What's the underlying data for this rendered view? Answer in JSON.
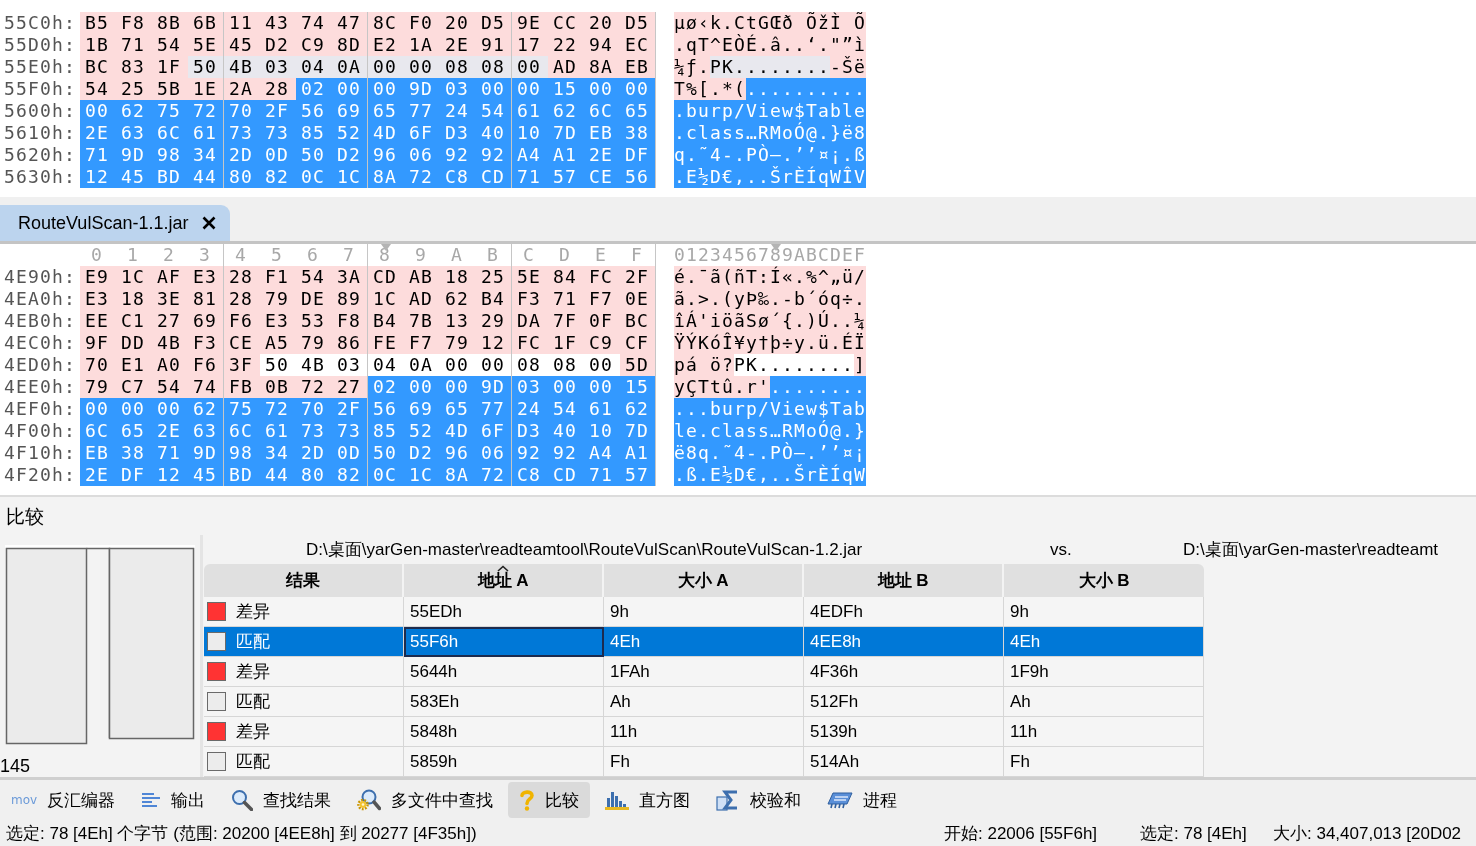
{
  "hex_views": [
    {
      "focused": false,
      "rows": [
        {
          "offset": "55C0h:",
          "segments": [
            {
              "kind": "diff",
              "hex": [
                "B5",
                "F8",
                "8B",
                "6B",
                "11",
                "43",
                "74",
                "47",
                "8C",
                "F0",
                "20",
                "D5",
                "9E",
                "CC",
                "20",
                "D5"
              ],
              "text": "µø‹k.CtGŒð ÕžÌ Õ"
            }
          ]
        },
        {
          "offset": "55D0h:",
          "segments": [
            {
              "kind": "diff",
              "hex": [
                "1B",
                "71",
                "54",
                "5E",
                "45",
                "D2",
                "C9",
                "8D",
                "E2",
                "1A",
                "2E",
                "91",
                "17",
                "22",
                "94",
                "EC"
              ],
              "text": ".qT^EÒÉ.â..‘.\"”ì"
            }
          ]
        },
        {
          "offset": "55E0h:",
          "segments": [
            {
              "kind": "diff",
              "hex": [
                "BC",
                "83",
                "1F"
              ],
              "text": "¼ƒ."
            },
            {
              "kind": "match",
              "hex": [
                "50",
                "4B",
                "03",
                "04",
                "0A",
                "00",
                "00",
                "08",
                "08",
                "00"
              ],
              "text": "PK........"
            },
            {
              "kind": "diff",
              "hex": [
                "AD",
                "8A",
                "EB"
              ],
              "text": "-Šë"
            }
          ]
        },
        {
          "offset": "55F0h:",
          "segments": [
            {
              "kind": "diff",
              "hex": [
                "54",
                "25",
                "5B",
                "1E",
                "2A",
                "28"
              ],
              "text": "T%[.*("
            },
            {
              "kind": "selected",
              "hex": [
                "02",
                "00",
                "00",
                "9D",
                "03",
                "00",
                "00",
                "15",
                "00",
                "00"
              ],
              "text": ".........."
            }
          ]
        },
        {
          "offset": "5600h:",
          "segments": [
            {
              "kind": "selected",
              "hex": [
                "00",
                "62",
                "75",
                "72",
                "70",
                "2F",
                "56",
                "69",
                "65",
                "77",
                "24",
                "54",
                "61",
                "62",
                "6C",
                "65"
              ],
              "text": ".burp/View$Table"
            }
          ]
        },
        {
          "offset": "5610h:",
          "segments": [
            {
              "kind": "selected",
              "hex": [
                "2E",
                "63",
                "6C",
                "61",
                "73",
                "73",
                "85",
                "52",
                "4D",
                "6F",
                "D3",
                "40",
                "10",
                "7D",
                "EB",
                "38"
              ],
              "text": ".class…RMoÓ@.}ë8"
            }
          ]
        },
        {
          "offset": "5620h:",
          "segments": [
            {
              "kind": "selected",
              "hex": [
                "71",
                "9D",
                "98",
                "34",
                "2D",
                "0D",
                "50",
                "D2",
                "96",
                "06",
                "92",
                "92",
                "A4",
                "A1",
                "2E",
                "DF"
              ],
              "text": "q.˜4-.PÒ–.’’¤¡.ß"
            }
          ]
        },
        {
          "offset": "5630h:",
          "segments": [
            {
              "kind": "selected",
              "hex": [
                "12",
                "45",
                "BD",
                "44",
                "80",
                "82",
                "0C",
                "1C",
                "8A",
                "72",
                "C8",
                "CD",
                "71",
                "57",
                "CE",
                "56"
              ],
              "text": ".E½D€‚..ŠrÈÍqWÎV"
            }
          ]
        }
      ]
    },
    {
      "tab": {
        "label": "RouteVulScan-1.1.jar",
        "selected": true
      },
      "focused": true,
      "columns": [
        {
          "label": "0",
          "marked": false
        },
        {
          "label": "1",
          "marked": false
        },
        {
          "label": "2",
          "marked": false
        },
        {
          "label": "3",
          "marked": false
        },
        {
          "label": "4",
          "marked": false
        },
        {
          "label": "5",
          "marked": false
        },
        {
          "label": "6",
          "marked": false
        },
        {
          "label": "7",
          "marked": false
        },
        {
          "label": "8",
          "marked": true
        },
        {
          "label": "9",
          "marked": false
        },
        {
          "label": "A",
          "marked": false
        },
        {
          "label": "B",
          "marked": false
        },
        {
          "label": "C",
          "marked": false
        },
        {
          "label": "D",
          "marked": false
        },
        {
          "label": "E",
          "marked": false
        },
        {
          "label": "F",
          "marked": false
        }
      ],
      "text_header": "0123456789ABCDEF",
      "rows": [
        {
          "offset": "4E90h:",
          "segments": [
            {
              "kind": "diff",
              "hex": [
                "E9",
                "1C",
                "AF",
                "E3",
                "28",
                "F1",
                "54",
                "3A",
                "CD",
                "AB",
                "18",
                "25",
                "5E",
                "84",
                "FC",
                "2F"
              ],
              "text": "é.¯ã(ñT:Í«.%^„ü/"
            }
          ]
        },
        {
          "offset": "4EA0h:",
          "segments": [
            {
              "kind": "diff",
              "hex": [
                "E3",
                "18",
                "3E",
                "81",
                "28",
                "79",
                "DE",
                "89",
                "1C",
                "AD",
                "62",
                "B4",
                "F3",
                "71",
                "F7",
                "0E"
              ],
              "text": "ã.>.(yÞ‰.-b´óq÷."
            }
          ]
        },
        {
          "offset": "4EB0h:",
          "segments": [
            {
              "kind": "diff",
              "hex": [
                "EE",
                "C1",
                "27",
                "69",
                "F6",
                "E3",
                "53",
                "F8",
                "B4",
                "7B",
                "13",
                "29",
                "DA",
                "7F",
                "0F",
                "BC"
              ],
              "text": "îÁ'iöãSø´{.)Ú..¼"
            }
          ]
        },
        {
          "offset": "4EC0h:",
          "segments": [
            {
              "kind": "diff",
              "hex": [
                "9F",
                "DD",
                "4B",
                "F3",
                "CE",
                "A5",
                "79",
                "86",
                "FE",
                "F7",
                "79",
                "12",
                "FC",
                "1F",
                "C9",
                "CF"
              ],
              "text": "ŸÝKóÎ¥y†þ÷y.ü.ÉÏ"
            }
          ]
        },
        {
          "offset": "4ED0h:",
          "segments": [
            {
              "kind": "diff",
              "hex": [
                "70",
                "E1",
                "A0",
                "F6",
                "3F"
              ],
              "text": "pá ö?"
            },
            {
              "kind": "match",
              "hex": [
                "50",
                "4B",
                "03",
                "04",
                "0A",
                "00",
                "00",
                "08",
                "08",
                "00"
              ],
              "text": "PK........"
            },
            {
              "kind": "diff",
              "hex": [
                "5D"
              ],
              "text": "]"
            }
          ]
        },
        {
          "offset": "4EE0h:",
          "segments": [
            {
              "kind": "diff",
              "hex": [
                "79",
                "C7",
                "54",
                "74",
                "FB",
                "0B",
                "72",
                "27"
              ],
              "text": "yÇTtû.r'"
            },
            {
              "kind": "selected",
              "hex": [
                "02",
                "00",
                "00",
                "9D",
                "03",
                "00",
                "00",
                "15"
              ],
              "text": "........"
            }
          ]
        },
        {
          "offset": "4EF0h:",
          "segments": [
            {
              "kind": "selected",
              "hex": [
                "00",
                "00",
                "00",
                "62",
                "75",
                "72",
                "70",
                "2F",
                "56",
                "69",
                "65",
                "77",
                "24",
                "54",
                "61",
                "62"
              ],
              "text": "...burp/View$Tab"
            }
          ]
        },
        {
          "offset": "4F00h:",
          "segments": [
            {
              "kind": "selected",
              "hex": [
                "6C",
                "65",
                "2E",
                "63",
                "6C",
                "61",
                "73",
                "73",
                "85",
                "52",
                "4D",
                "6F",
                "D3",
                "40",
                "10",
                "7D"
              ],
              "text": "le.class…RMoÓ@.}"
            }
          ]
        },
        {
          "offset": "4F10h:",
          "segments": [
            {
              "kind": "selected",
              "hex": [
                "EB",
                "38",
                "71",
                "9D",
                "98",
                "34",
                "2D",
                "0D",
                "50",
                "D2",
                "96",
                "06",
                "92",
                "92",
                "A4",
                "A1"
              ],
              "text": "ë8q.˜4-.PÒ–.’’¤¡"
            }
          ]
        },
        {
          "offset": "4F20h:",
          "segments": [
            {
              "kind": "selected",
              "hex": [
                "2E",
                "DF",
                "12",
                "45",
                "BD",
                "44",
                "80",
                "82",
                "0C",
                "1C",
                "8A",
                "72",
                "C8",
                "CD",
                "71",
                "57"
              ],
              "text": ".ß.E½D€‚..ŠrÈÍqW"
            }
          ]
        }
      ]
    }
  ],
  "compare": {
    "title": "比较",
    "overview_count": "145",
    "file_a": "D:\\桌面\\yarGen-master\\readteamtool\\RouteVulScan\\RouteVulScan-1.2.jar",
    "versus": "vs.",
    "file_b": "D:\\桌面\\yarGen-master\\readteamt",
    "columns": [
      {
        "label": "结果",
        "sorted": false
      },
      {
        "label": "地址 A",
        "sorted": true
      },
      {
        "label": "大小 A",
        "sorted": false
      },
      {
        "label": "地址 B",
        "sorted": false
      },
      {
        "label": "大小 B",
        "sorted": false
      }
    ],
    "rows": [
      {
        "result": "差异",
        "color": "#ff3333",
        "selected": false,
        "cells": [
          {
            "text": "55EDh",
            "focused": false
          },
          {
            "text": "9h",
            "focused": false
          },
          {
            "text": "4EDFh",
            "focused": false
          },
          {
            "text": "9h",
            "focused": false
          }
        ]
      },
      {
        "result": "匹配",
        "color": "#ececec",
        "selected": true,
        "cells": [
          {
            "text": "55F6h",
            "focused": true
          },
          {
            "text": "4Eh",
            "focused": false
          },
          {
            "text": "4EE8h",
            "focused": false
          },
          {
            "text": "4Eh",
            "focused": false
          }
        ]
      },
      {
        "result": "差异",
        "color": "#ff3333",
        "selected": false,
        "cells": [
          {
            "text": "5644h",
            "focused": false
          },
          {
            "text": "1FAh",
            "focused": false
          },
          {
            "text": "4F36h",
            "focused": false
          },
          {
            "text": "1F9h",
            "focused": false
          }
        ]
      },
      {
        "result": "匹配",
        "color": "#ececec",
        "selected": false,
        "cells": [
          {
            "text": "583Eh",
            "focused": false
          },
          {
            "text": "Ah",
            "focused": false
          },
          {
            "text": "512Fh",
            "focused": false
          },
          {
            "text": "Ah",
            "focused": false
          }
        ]
      },
      {
        "result": "差异",
        "color": "#ff3333",
        "selected": false,
        "cells": [
          {
            "text": "5848h",
            "focused": false
          },
          {
            "text": "11h",
            "focused": false
          },
          {
            "text": "5139h",
            "focused": false
          },
          {
            "text": "11h",
            "focused": false
          }
        ]
      },
      {
        "result": "匹配",
        "color": "#ececec",
        "selected": false,
        "cells": [
          {
            "text": "5859h",
            "focused": false
          },
          {
            "text": "Fh",
            "focused": false
          },
          {
            "text": "514Ah",
            "focused": false
          },
          {
            "text": "Fh",
            "focused": false
          }
        ]
      }
    ]
  },
  "tool_tabs": [
    {
      "label": "反汇编器",
      "icon_text": "mov",
      "selected": false
    },
    {
      "label": "输出",
      "selected": false
    },
    {
      "label": "查找结果",
      "selected": false
    },
    {
      "label": "多文件中查找",
      "selected": false
    },
    {
      "label": "比较",
      "selected": true
    },
    {
      "label": "直方图",
      "selected": false
    },
    {
      "label": "校验和",
      "selected": false
    },
    {
      "label": "进程",
      "selected": false
    }
  ],
  "status_bar": {
    "selection_info": "选定: 78 [4Eh] 个字节 (范围: 20200 [4EE8h] 到 20277 [4F35h])",
    "start": "开始: 22006 [55F6h]",
    "selection": "选定: 78 [4Eh]",
    "size": "大小: 34,407,013 [20D02"
  }
}
